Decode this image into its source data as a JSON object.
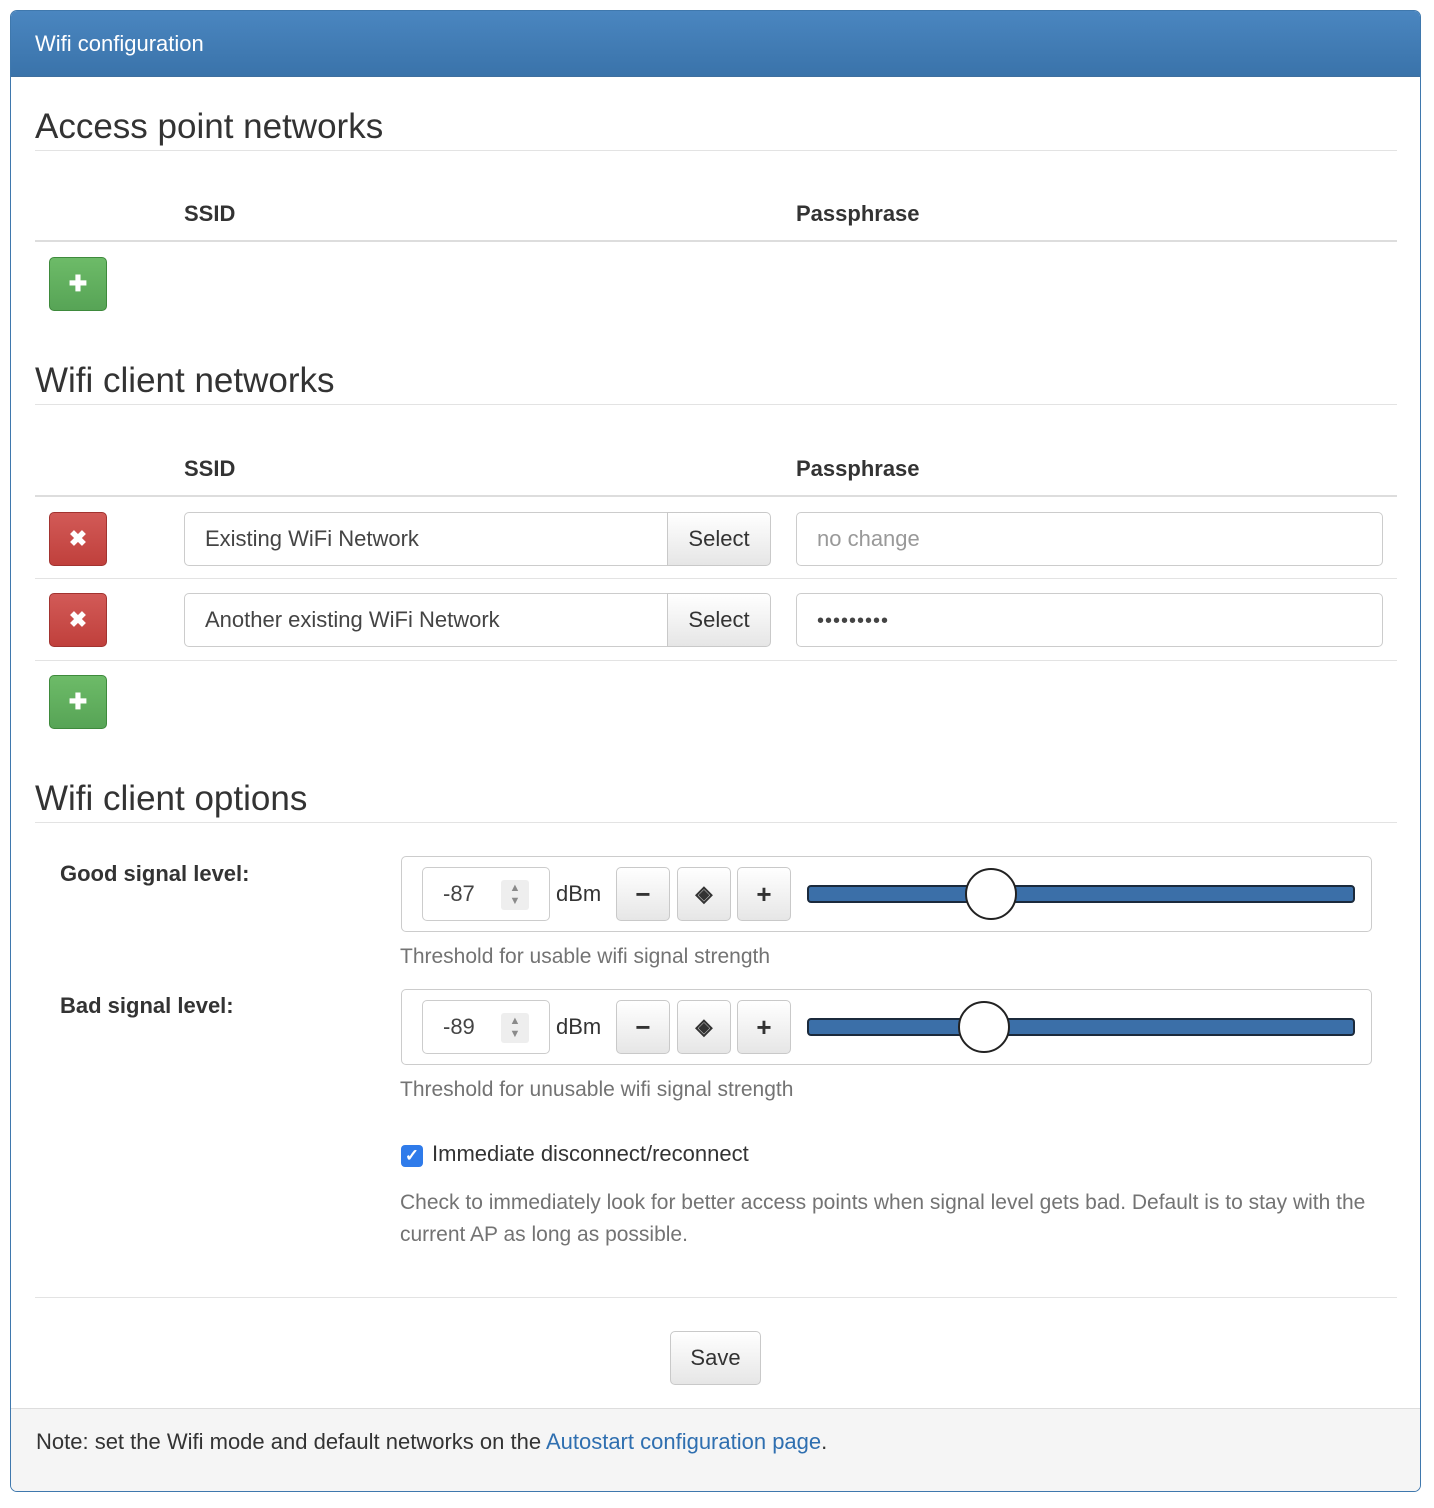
{
  "panel": {
    "title": "Wifi configuration"
  },
  "ap_section": {
    "title": "Access point networks",
    "col_ssid": "SSID",
    "col_passphrase": "Passphrase",
    "add_icon": "plus-icon"
  },
  "client_section": {
    "title": "Wifi client networks",
    "col_ssid": "SSID",
    "col_passphrase": "Passphrase",
    "remove_icon": "close-icon",
    "add_icon": "plus-icon",
    "networks": [
      {
        "ssid": "Existing WiFi Network",
        "select_label": "Select",
        "passphrase_placeholder": "no change",
        "passphrase_value": ""
      },
      {
        "ssid": "Another existing WiFi Network",
        "select_label": "Select",
        "passphrase_placeholder": "",
        "passphrase_value": "•••••••••"
      }
    ]
  },
  "options_section": {
    "title": "Wifi client options",
    "good_signal": {
      "label": "Good signal level:",
      "value": "-87",
      "unit": "dBm",
      "minus": "−",
      "reset": "◈",
      "plus": "+",
      "help": "Threshold for usable wifi signal strength"
    },
    "bad_signal": {
      "label": "Bad signal level:",
      "value": "-89",
      "unit": "dBm",
      "minus": "−",
      "reset": "◈",
      "plus": "+",
      "help": "Threshold for unusable wifi signal strength"
    },
    "immediate": {
      "label": "Immediate disconnect/reconnect",
      "checked": true,
      "help": "Check to immediately look for better access points when signal level gets bad. Default is to stay with the current AP as long as possible."
    }
  },
  "save_label": "Save",
  "footer": {
    "note_prefix": "Note: set the Wifi mode and default networks on the ",
    "link_text": "Autostart configuration page",
    "note_suffix": "."
  },
  "colors": {
    "heading_bg": "#3f7ab5",
    "add_green": "#5cb85c",
    "remove_red": "#c9302c",
    "slider_fill": "#3b6fa8",
    "link": "#2f6fb0",
    "checkbox": "#2f7bea"
  }
}
